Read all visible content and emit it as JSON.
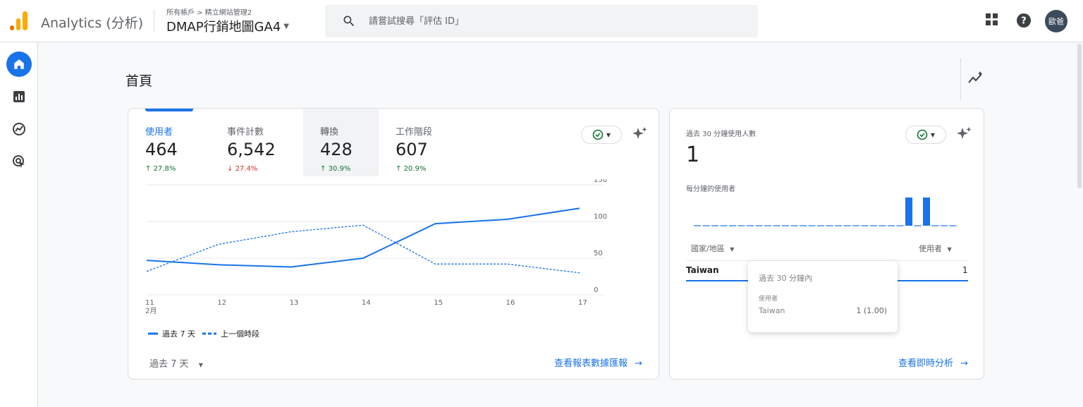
{
  "app": {
    "name": "Analytics (分析)",
    "breadcrumb": "所有帳戶 > 精立網站管理2",
    "property": "DMAP行銷地圖GA4"
  },
  "search": {
    "placeholder": "請嘗試搜尋「評估 ID」"
  },
  "user": {
    "avatar_text": "歐爸"
  },
  "nav": {
    "items": [
      "home-icon",
      "reports-icon",
      "explore-icon",
      "advertising-icon"
    ]
  },
  "page": {
    "title": "首頁"
  },
  "overview": {
    "metrics": [
      {
        "label": "使用者",
        "value": "464",
        "change": "27.8%",
        "direction": "up"
      },
      {
        "label": "事件計數",
        "value": "6,542",
        "change": "27.4%",
        "direction": "down"
      },
      {
        "label": "轉換",
        "value": "428",
        "change": "30.9%",
        "direction": "up"
      },
      {
        "label": "工作階段",
        "value": "607",
        "change": "20.9%",
        "direction": "up"
      }
    ],
    "legend_current": "過去 7 天",
    "legend_previous": "上一個時段",
    "date_range": "過去 7 天",
    "link": "查看報表數據匯報"
  },
  "chart_data": {
    "type": "line",
    "x": [
      "11",
      "12",
      "13",
      "14",
      "15",
      "16",
      "17"
    ],
    "x_sublabel": "2月",
    "y_ticks": [
      "0",
      "50",
      "100",
      "150"
    ],
    "ylim": [
      0,
      150
    ],
    "series": [
      {
        "name": "過去 7 天",
        "values": [
          47,
          41,
          38,
          50,
          97,
          103,
          118
        ],
        "style": "solid",
        "color": "#1a73e8"
      },
      {
        "name": "上一個時段",
        "values": [
          32,
          69,
          86,
          95,
          42,
          42,
          30
        ],
        "style": "dashed",
        "color": "#1a73e8"
      }
    ]
  },
  "realtime": {
    "title": "過去 30 分鐘使用人數",
    "value": "1",
    "per_minute_label": "每分鐘的使用者",
    "per_minute_values": [
      0,
      0,
      0,
      0,
      0,
      0,
      0,
      0,
      0,
      0,
      0,
      0,
      0,
      0,
      0,
      0,
      0,
      0,
      0,
      0,
      0,
      0,
      0,
      0,
      1,
      0,
      1,
      0,
      0,
      0
    ],
    "col_country": "國家/地區",
    "col_users": "使用者",
    "rows": [
      {
        "country": "Taiwan",
        "users": "1"
      }
    ],
    "link": "查看即時分析",
    "tooltip": {
      "title": "過去 30 分鐘內",
      "metric": "使用者",
      "country": "Taiwan",
      "value": "1 (1.00)"
    }
  },
  "colors": {
    "accent": "#1a73e8",
    "up": "#137333",
    "down": "#d93025",
    "logo_orange": "#f9ab00",
    "logo_dark": "#e37400"
  }
}
